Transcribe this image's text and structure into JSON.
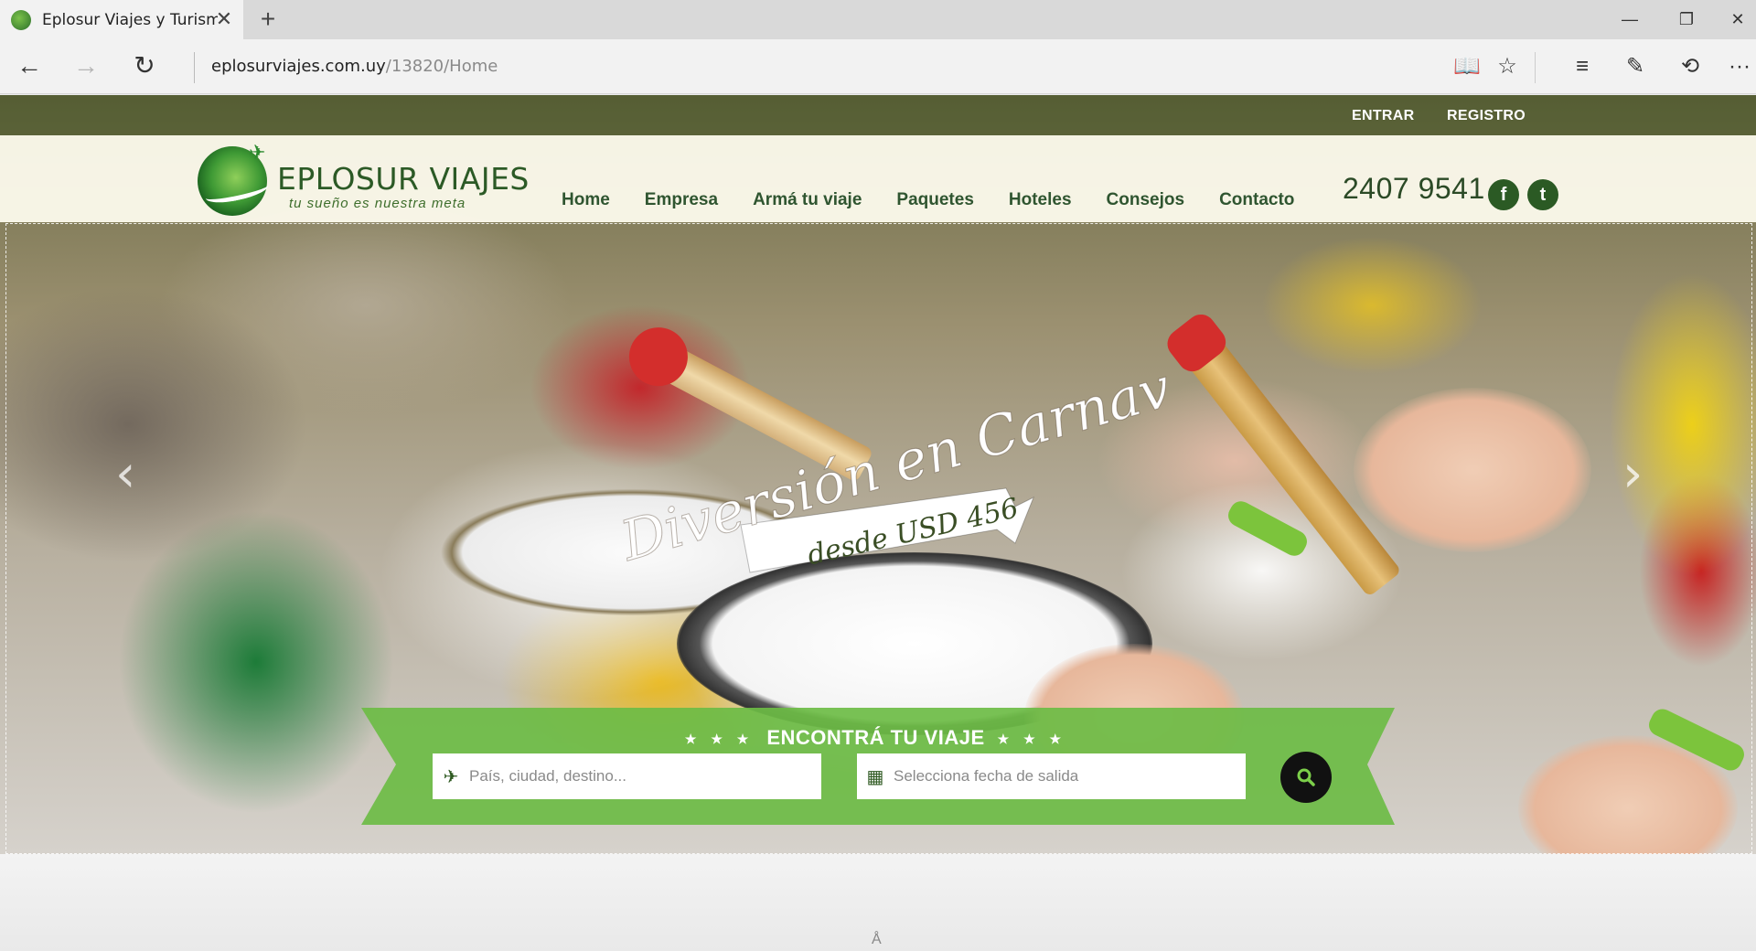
{
  "browser": {
    "tab_title": "Eplosur Viajes y Turismo",
    "tab_close": "✕",
    "new_tab": "+",
    "url_host": "eplosurviajes.com.uy",
    "url_path": "/13820/Home",
    "window": {
      "minimize": "—",
      "restore": "❐",
      "close": "✕"
    },
    "nav": {
      "back": "←",
      "forward": "→",
      "refresh": "↻"
    },
    "tools": {
      "reading_view": "📖",
      "favorite": "☆",
      "hub": "≡",
      "web_note": "✎",
      "share": "⟲",
      "more": "···"
    }
  },
  "site": {
    "topbar": {
      "login": "ENTRAR",
      "register": "REGISTRO"
    },
    "logo": {
      "name": "EPLOSUR VIAJES",
      "tagline": "tu sueño es nuestra meta",
      "plane": "✈"
    },
    "menu": [
      "Home",
      "Empresa",
      "Armá tu viaje",
      "Paquetes",
      "Hoteles",
      "Consejos",
      "Contacto"
    ],
    "phone": "2407 9541",
    "social": {
      "facebook": "f",
      "twitter": "t"
    },
    "slider": {
      "prev": "‹",
      "next": "›"
    },
    "promo": {
      "title": "Diversión en Carnaval",
      "price": "desde USD 456"
    },
    "search": {
      "stars": "★ ★ ★",
      "title": "ENCONTRÁ TU VIAJE",
      "destination_placeholder": "País, ciudad, destino...",
      "date_placeholder": "Selecciona fecha de salida"
    },
    "footer_mark": "Å"
  },
  "colors": {
    "brand_green": "#6cbc45",
    "dark_green": "#2b5a24",
    "banner_green": "rgba(108,188,69,0.92)"
  }
}
